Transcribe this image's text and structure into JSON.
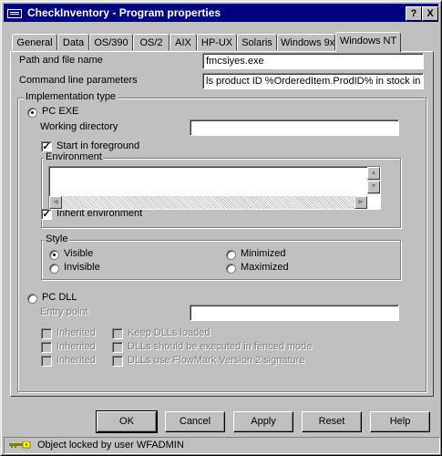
{
  "window": {
    "title": "CheckInventory - Program properties",
    "help_btn": "?",
    "close_btn": "X"
  },
  "tabs": [
    {
      "label": "General"
    },
    {
      "label": "Data"
    },
    {
      "label": "OS/390"
    },
    {
      "label": "OS/2"
    },
    {
      "label": "AIX"
    },
    {
      "label": "HP-UX"
    },
    {
      "label": "Solaris"
    },
    {
      "label": "Windows 9x"
    },
    {
      "label": "Windows NT",
      "active": true
    }
  ],
  "form": {
    "path_label": "Path and file name",
    "path_value": "fmcsiyes.exe",
    "cmd_label": "Command line parameters",
    "cmd_value": "ls product ID %OrderedItem.ProdID% in stock in quanti"
  },
  "implementation": {
    "title": "Implementation type",
    "pc_exe_label": "PC EXE",
    "pc_exe_selected": true,
    "working_dir_label": "Working directory",
    "working_dir_value": "",
    "start_fg_label": "Start in foreground",
    "start_fg_checked": true,
    "environment_title": "Environment",
    "environment_value": "",
    "inherit_env_label": "Inherit environment",
    "inherit_env_checked": true,
    "style": {
      "title": "Style",
      "visible": "Visible",
      "invisible": "Invisible",
      "minimized": "Minimized",
      "maximized": "Maximized",
      "selected": "Visible"
    },
    "pc_dll_label": "PC DLL",
    "pc_dll_selected": false,
    "entry_point_label": "Entry point",
    "entry_point_value": "",
    "inherited_1": "Inherited",
    "inherited_2": "Inherited",
    "inherited_3": "Inherited",
    "keep_dlls": "Keep DLLs loaded",
    "fenced_mode": "DLLs should be executed in fenced mode",
    "flowmark_v2": "DLLs use FlowMark Version 2 signature"
  },
  "buttons": {
    "ok": "OK",
    "cancel": "Cancel",
    "apply": "Apply",
    "reset": "Reset",
    "help": "Help"
  },
  "status": {
    "text": "Object locked by user WFADMIN",
    "icon": "key-icon"
  },
  "colors": {
    "titlebar": "#000080",
    "face": "#c0c0c0"
  }
}
